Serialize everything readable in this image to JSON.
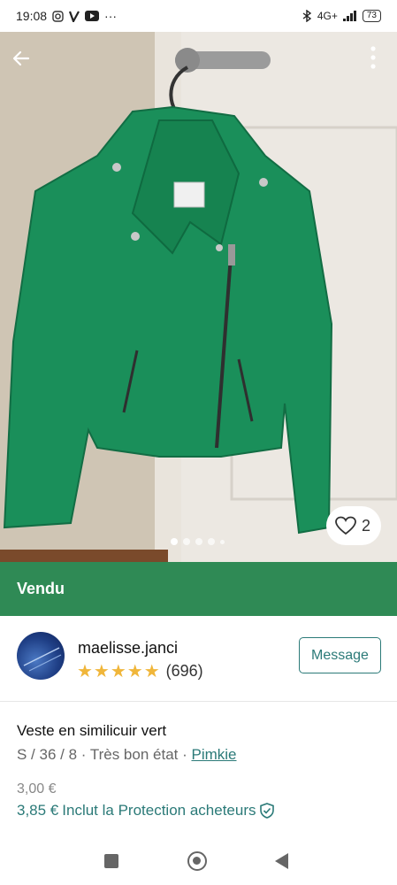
{
  "status_bar": {
    "time": "19:08",
    "left_icons": [
      "instagram-icon",
      "vinted-icon",
      "youtube-icon",
      "more-dots-icon"
    ],
    "network": "4G+",
    "battery": "73"
  },
  "photo": {
    "image_count": 5,
    "active_index": 0,
    "likes": "2",
    "jacket_color": "#1a8f5a"
  },
  "banner": {
    "label": "Vendu",
    "color": "#2f8a55"
  },
  "seller": {
    "name": "maelisse.janci",
    "stars": "★★★★★",
    "rating_value": 5,
    "reviews": "(696)",
    "message_label": "Message"
  },
  "item": {
    "title": "Veste en similicuir vert",
    "details": "S / 36 / 8 · Très bon état · ",
    "brand": "Pimkie"
  },
  "price": {
    "base": "3,00 €",
    "total": "3,85 €",
    "protection_label": "Inclut la Protection acheteurs"
  },
  "colors": {
    "accent": "#2b7a78",
    "star": "#f0b63a"
  }
}
